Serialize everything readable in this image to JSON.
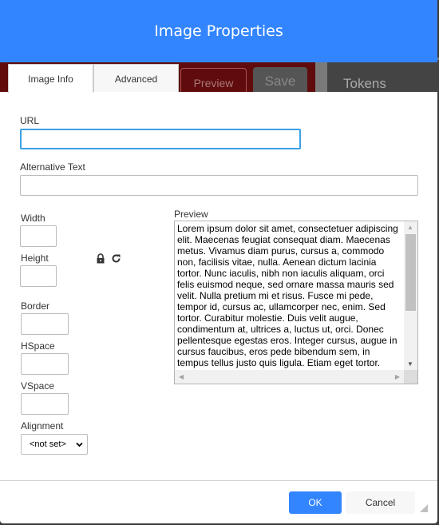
{
  "dialog": {
    "title": "Image Properties"
  },
  "background": {
    "preview": "Preview",
    "save": "Save",
    "tokens": "Tokens"
  },
  "tabs": [
    {
      "label": "Image Info",
      "active": true
    },
    {
      "label": "Advanced",
      "active": false
    }
  ],
  "fields": {
    "url": {
      "label": "URL",
      "value": ""
    },
    "alt": {
      "label": "Alternative Text",
      "value": ""
    },
    "width": {
      "label": "Width",
      "value": ""
    },
    "height": {
      "label": "Height",
      "value": ""
    },
    "border": {
      "label": "Border",
      "value": ""
    },
    "hspace": {
      "label": "HSpace",
      "value": ""
    },
    "vspace": {
      "label": "VSpace",
      "value": ""
    },
    "alignment": {
      "label": "Alignment",
      "value": "<not set>"
    }
  },
  "icons": {
    "lock": "lock-icon",
    "reset": "reset-size-icon"
  },
  "preview": {
    "label": "Preview",
    "text": "Lorem ipsum dolor sit amet, consectetuer adipiscing elit. Maecenas feugiat consequat diam. Maecenas metus. Vivamus diam purus, cursus a, commodo non, facilisis vitae, nulla. Aenean dictum lacinia tortor. Nunc iaculis, nibh non iaculis aliquam, orci felis euismod neque, sed ornare massa mauris sed velit. Nulla pretium mi et risus. Fusce mi pede, tempor id, cursus ac, ullamcorper nec, enim. Sed tortor. Curabitur molestie. Duis velit augue, condimentum at, ultrices a, luctus ut, orci. Donec pellentesque egestas eros. Integer cursus, augue in cursus faucibus, eros pede bibendum sem, in tempus tellus justo quis ligula. Etiam eget tortor."
  },
  "footer": {
    "ok": "OK",
    "cancel": "Cancel"
  },
  "colors": {
    "accent": "#3385ff"
  }
}
